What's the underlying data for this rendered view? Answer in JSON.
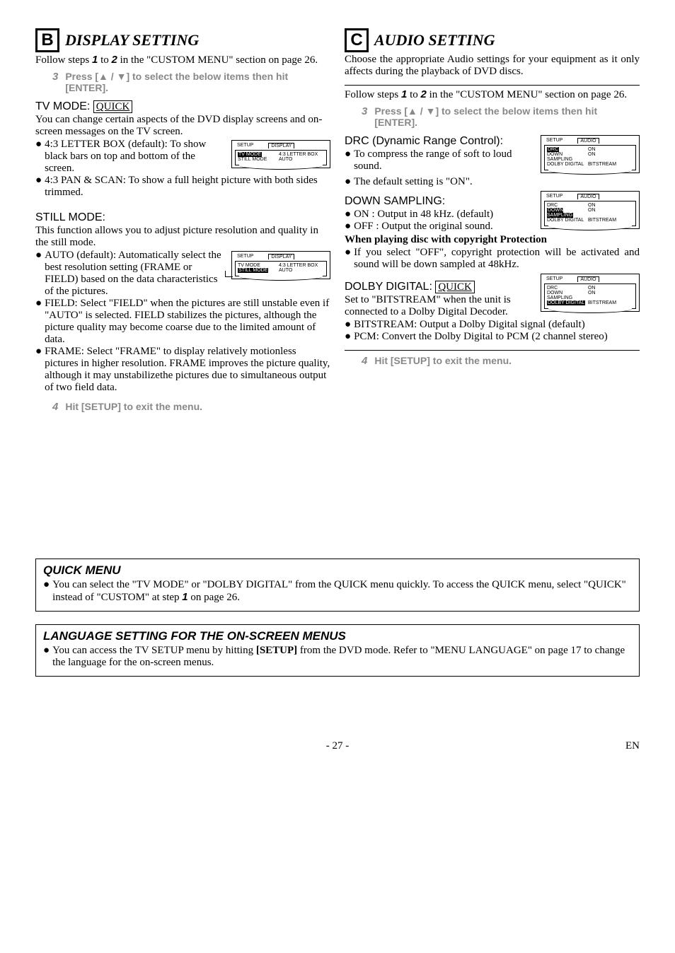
{
  "colB": {
    "letter": "B",
    "heading": "DISPLAY SETTING",
    "intro1": "Follow steps ",
    "introNum1": "1",
    "intro2": " to ",
    "introNum2": "2",
    "intro3": " in the \"CUSTOM MENU\" section on page 26.",
    "step3num": "3",
    "step3a": "Press [",
    "step3arrows": "▲ / ▼",
    "step3b": "] to select the below items then hit [ENTER].",
    "tvmode": {
      "label": "TV MODE: ",
      "quick": "QUICK",
      "desc": "You can change certain aspects of the DVD display screens and on-screen messages on the TV screen.",
      "b1": "4:3 LETTER BOX (default): To show black bars on top and bottom of the screen.",
      "b2": "4:3 PAN & SCAN: To show a full height picture with both sides trimmed.",
      "menu": {
        "tab1": "SETUP",
        "tab2": "DISPLAY",
        "r1k": "TV MODE",
        "r1v": "4:3 LETTER BOX",
        "r2k": "STILL MODE",
        "r2v": "AUTO"
      }
    },
    "still": {
      "label": "STILL MODE:",
      "desc": "This function allows you to adjust picture resolution and quality in the still mode.",
      "b1": "AUTO (default): Automatically select the best resolution setting (FRAME or FIELD) based on the data characteristics of the pictures.",
      "b2": "FIELD: Select \"FIELD\" when the pictures are still unstable even if \"AUTO\" is selected. FIELD stabilizes the pictures, although the picture quality may become coarse due to the limited amount of data.",
      "b3": "FRAME: Select \"FRAME\" to display relatively motionless pictures in higher resolution. FRAME improves the picture quality, although it may unstabilizethe pictures due to simultaneous output of two field data.",
      "menu": {
        "tab1": "SETUP",
        "tab2": "DISPLAY",
        "r1k": "TV MODE",
        "r1v": "4:3 LETTER BOX",
        "r2k": "STILL MODE",
        "r2v": "AUTO"
      }
    },
    "step4num": "4",
    "step4text": "Hit [SETUP] to exit the menu."
  },
  "colC": {
    "letter": "C",
    "heading": "AUDIO SETTING",
    "intro": "Choose the appropriate Audio settings for your equipment as it only affects during the playback of DVD discs.",
    "intro1": "Follow steps ",
    "introNum1": "1",
    "intro2": " to ",
    "introNum2": "2",
    "intro3": " in the \"CUSTOM MENU\" section on page 26.",
    "step3num": "3",
    "step3a": "Press [",
    "step3arrows": "▲ / ▼",
    "step3b": "] to select the below items then hit [ENTER].",
    "drc": {
      "label": "DRC (Dynamic Range Control):",
      "b1": "To compress the range of soft to loud sound.",
      "b2": "The default setting is \"ON\".",
      "menu": {
        "tab1": "SETUP",
        "tab2": "AUDIO",
        "r1k": "DRC",
        "r1v": "ON",
        "r2k": "DOWN SAMPLING",
        "r2v": "ON",
        "r3k": "DOLBY DIGITAL",
        "r3v": "BITSTREAM"
      }
    },
    "down": {
      "label": "DOWN SAMPLING:",
      "b1": "ON : Output in 48 kHz. (default)",
      "b2": "OFF : Output the original sound.",
      "note_title": "When playing disc with copyright Protection",
      "b3": "If you select \"OFF\", copyright protection will be activated and sound will be down sampled at 48kHz.",
      "menu": {
        "tab1": "SETUP",
        "tab2": "AUDIO",
        "r1k": "DRC",
        "r1v": "ON",
        "r2k": "DOWN SAMPLING",
        "r2v": "ON",
        "r3k": "DOLBY DIGITAL",
        "r3v": "BITSTREAM"
      }
    },
    "dolby": {
      "label": "DOLBY DIGITAL: ",
      "quick": "QUICK",
      "desc": "Set to \"BITSTREAM\" when the unit is connected to a Dolby Digital Decoder.",
      "b1": "BITSTREAM: Output a Dolby Digital signal (default)",
      "b2": "PCM: Convert the Dolby Digital to PCM (2 channel stereo)",
      "menu": {
        "tab1": "SETUP",
        "tab2": "AUDIO",
        "r1k": "DRC",
        "r1v": "ON",
        "r2k": "DOWN SAMPLING",
        "r2v": "ON",
        "r3k": "DOLBY DIGITAL",
        "r3v": "BITSTREAM"
      }
    },
    "step4num": "4",
    "step4text": "Hit [SETUP] to exit the menu."
  },
  "quickMenu": {
    "title": "QUICK MENU",
    "l1a": "You can select the \"TV MODE\" or \"DOLBY DIGITAL\" from the QUICK menu quickly. To access the QUICK menu, select \"QUICK\" instead of \"CUSTOM\" at step ",
    "l1num": "1",
    "l1b": " on page 26."
  },
  "langMenu": {
    "title": "LANGUAGE SETTING FOR THE ON-SCREEN MENUS",
    "l1a": "You can access the TV SETUP menu by hitting ",
    "l1bold": "[SETUP]",
    "l1b": " from the DVD mode. Refer to \"MENU LANGUAGE\" on page 17 to change the language for the on-screen menus."
  },
  "footer": {
    "page": "- 27 -",
    "en": "EN"
  }
}
